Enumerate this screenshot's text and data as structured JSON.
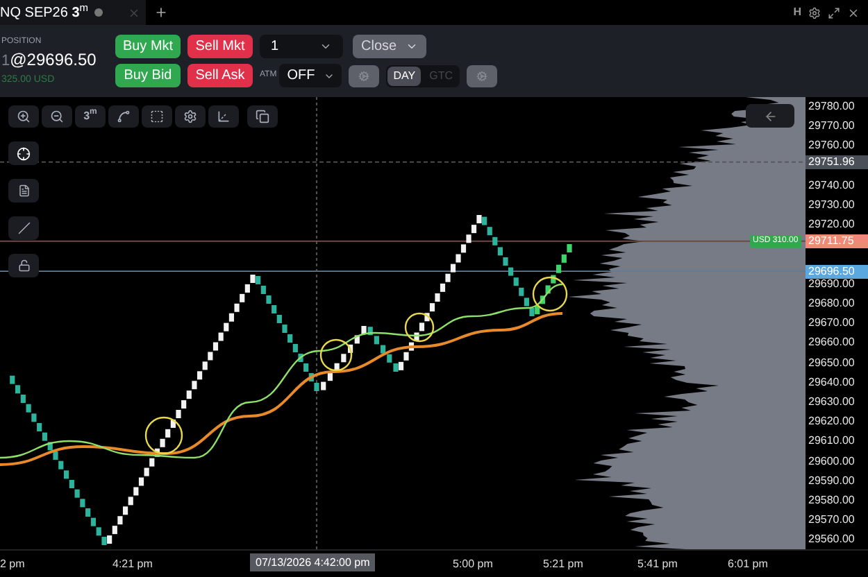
{
  "tab": {
    "title": "NQ SEP26 **3**$^{m}$",
    "connected": false
  },
  "window_controls": {
    "hotkey": "H"
  },
  "position": {
    "label": "POSITION",
    "quantity": "1",
    "price": "@29696.50",
    "pnl": "325.00 USD"
  },
  "order_buttons": [
    {
      "label": "Buy Mkt",
      "kind": "buy"
    },
    {
      "label": "Sell Mkt",
      "kind": "sell"
    },
    {
      "label": "Buy Bid",
      "kind": "buy"
    },
    {
      "label": "Sell Ask",
      "kind": "sell"
    }
  ],
  "quantity": {
    "value": "1"
  },
  "close_button": {
    "label": "Close",
    "disabled": true
  },
  "atm": {
    "label": "ATM",
    "value": "OFF"
  },
  "time_in_force": [
    {
      "label": "DAY",
      "selected": true
    },
    {
      "label": "GTC",
      "selected": false
    }
  ],
  "chart_toolbar": {
    "interval": "3$^{m}$"
  },
  "chart": {
    "price_labels": [
      "29780.00",
      "29770.00",
      "29760.00",
      "29740.00",
      "29730.00",
      "29720.00",
      "29690.00",
      "29680.00",
      "29670.00",
      "29660.00",
      "29650.00",
      "29640.00",
      "29630.00",
      "29620.00",
      "29610.00",
      "29600.00",
      "29590.00",
      "29580.00",
      "29570.00",
      "29560.00"
    ],
    "markers": [
      {
        "label": "29751.96",
        "color": "#4b4f58"
      },
      {
        "label": "29711.75",
        "color": "#f08a78",
        "badge": "USD 310.00"
      },
      {
        "label": "29696.50",
        "color": "#5ba8e0"
      }
    ],
    "time_labels": [
      {
        "label": "2 pm"
      },
      {
        "label": "4:21 pm"
      },
      {
        "label": "5:00 pm"
      },
      {
        "label": "5:21 pm"
      },
      {
        "label": "5:41 pm"
      },
      {
        "label": "6:01 pm"
      }
    ],
    "crosshair_time": "07/13/2026 4:42:00 pm"
  }
}
